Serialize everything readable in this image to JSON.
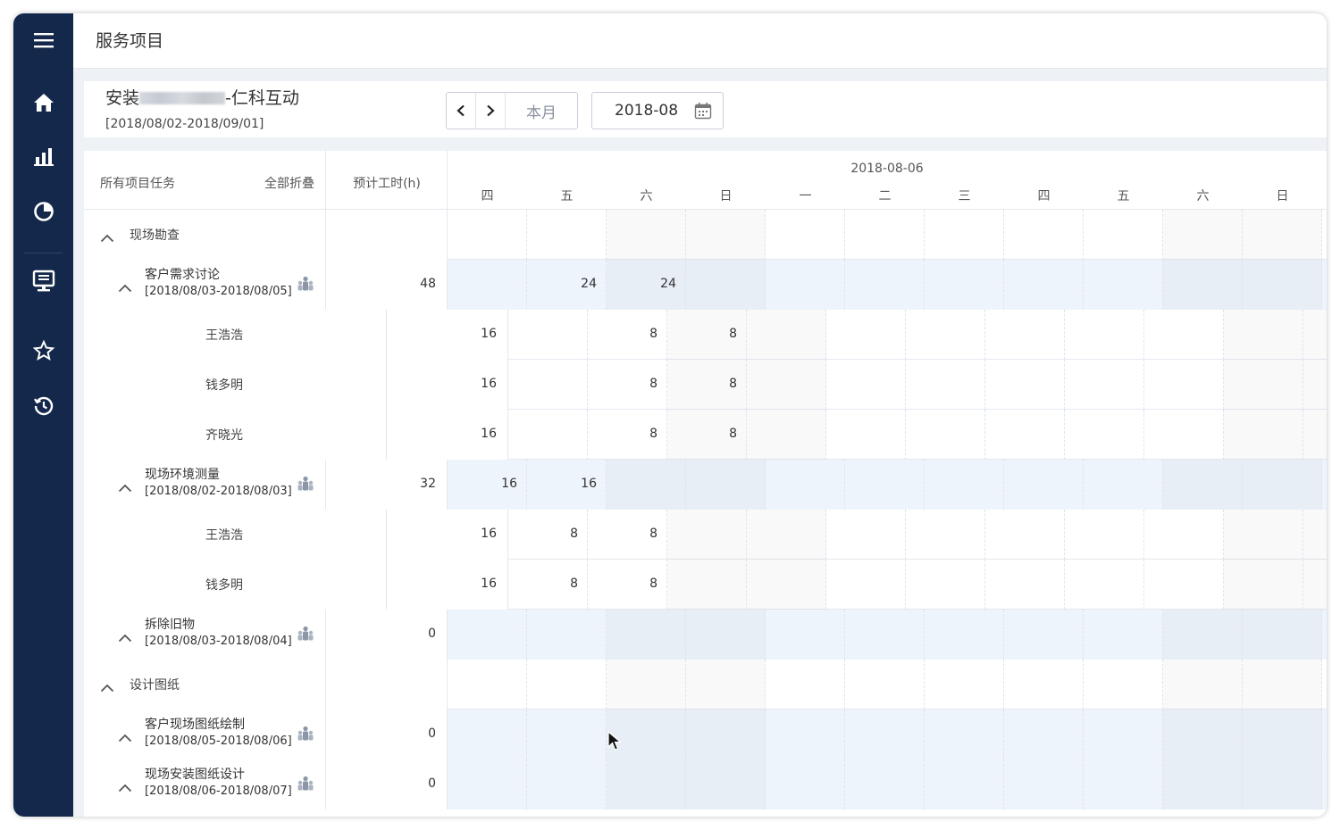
{
  "page_title": "服务项目",
  "project": {
    "name_prefix": "安装",
    "name_suffix": "-仁科互动",
    "date_range": "[2018/08/02-2018/09/01]"
  },
  "toolbar": {
    "prev_label": "<",
    "next_label": ">",
    "this_month_label": "本月",
    "month_value": "2018-08"
  },
  "grid_header": {
    "all_tasks": "所有项目任务",
    "collapse_all": "全部折叠",
    "planned_hours": "预计工时(h)",
    "week_date": "2018-08-06",
    "weekdays": [
      "四",
      "五",
      "六",
      "日",
      "一",
      "二",
      "三",
      "四",
      "五",
      "六",
      "日"
    ]
  },
  "rows": [
    {
      "kind": "category",
      "label": "现场勘查",
      "hours": "",
      "values": [
        "",
        "",
        "",
        "",
        "",
        "",
        "",
        "",
        "",
        "",
        ""
      ]
    },
    {
      "kind": "task",
      "name": "客户需求讨论",
      "range": "[2018/08/03-2018/08/05]",
      "hours": "48",
      "values": [
        "",
        "24",
        "24",
        "",
        "",
        "",
        "",
        "",
        "",
        "",
        ""
      ]
    },
    {
      "kind": "person",
      "name": "王浩浩",
      "hours": "16",
      "values": [
        "",
        "8",
        "8",
        "",
        "",
        "",
        "",
        "",
        "",
        "",
        ""
      ]
    },
    {
      "kind": "person",
      "name": "钱多明",
      "hours": "16",
      "values": [
        "",
        "8",
        "8",
        "",
        "",
        "",
        "",
        "",
        "",
        "",
        ""
      ]
    },
    {
      "kind": "person",
      "name": "齐晓光",
      "hours": "16",
      "values": [
        "",
        "8",
        "8",
        "",
        "",
        "",
        "",
        "",
        "",
        "",
        ""
      ]
    },
    {
      "kind": "task",
      "name": "现场环境测量",
      "range": "[2018/08/02-2018/08/03]",
      "hours": "32",
      "values": [
        "16",
        "16",
        "",
        "",
        "",
        "",
        "",
        "",
        "",
        "",
        ""
      ]
    },
    {
      "kind": "person",
      "name": "王浩浩",
      "hours": "16",
      "values": [
        "8",
        "8",
        "",
        "",
        "",
        "",
        "",
        "",
        "",
        "",
        ""
      ]
    },
    {
      "kind": "person",
      "name": "钱多明",
      "hours": "16",
      "values": [
        "8",
        "8",
        "",
        "",
        "",
        "",
        "",
        "",
        "",
        "",
        ""
      ]
    },
    {
      "kind": "task",
      "name": "拆除旧物",
      "range": "[2018/08/03-2018/08/04]",
      "hours": "0",
      "values": [
        "",
        "",
        "",
        "",
        "",
        "",
        "",
        "",
        "",
        "",
        ""
      ]
    },
    {
      "kind": "category",
      "label": "设计图纸",
      "hours": "",
      "values": [
        "",
        "",
        "",
        "",
        "",
        "",
        "",
        "",
        "",
        "",
        ""
      ]
    },
    {
      "kind": "task",
      "name": "客户现场图纸绘制",
      "range": "[2018/08/05-2018/08/06]",
      "hours": "0",
      "values": [
        "",
        "",
        "",
        "",
        "",
        "",
        "",
        "",
        "",
        "",
        ""
      ]
    },
    {
      "kind": "task",
      "name": "现场安装图纸设计",
      "range": "[2018/08/06-2018/08/07]",
      "hours": "0",
      "values": [
        "",
        "",
        "",
        "",
        "",
        "",
        "",
        "",
        "",
        "",
        ""
      ]
    }
  ],
  "sidebar_icons": [
    "menu-icon",
    "home-icon",
    "bar-chart-icon",
    "pie-chart-icon",
    "monitor-icon",
    "star-icon",
    "history-icon"
  ],
  "colors": {
    "sidebar": "#13284a",
    "task_row": "#eef4fb",
    "page_bg": "#eef2f7"
  }
}
